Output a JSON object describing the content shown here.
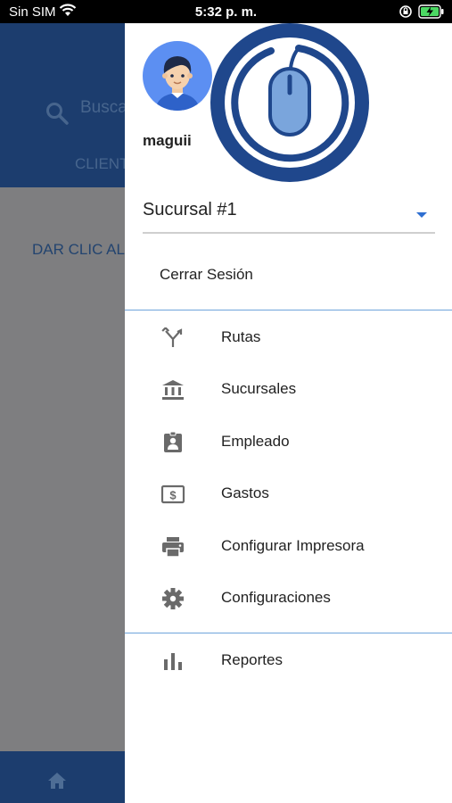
{
  "status_bar": {
    "carrier": "Sin SIM",
    "time": "5:32 p. m.",
    "icons": [
      "wifi-icon",
      "orientation-lock-icon",
      "battery-charging-icon"
    ]
  },
  "background_app": {
    "search_placeholder": "Busca",
    "tab_label": "CLIENT",
    "hint_text": "DAR CLIC AL",
    "header_color": "#1c3d6e",
    "overlay_color": "#7e7e80"
  },
  "drawer": {
    "username": "maguii",
    "branch_selected": "Sucursal #1",
    "logout_label": "Cerrar Sesión",
    "accent_color": "#2f6fd1",
    "menu_items": [
      {
        "label": "Rutas",
        "icon": "route-icon"
      },
      {
        "label": "Sucursales",
        "icon": "bank-icon"
      },
      {
        "label": "Empleado",
        "icon": "badge-icon"
      },
      {
        "label": "Gastos",
        "icon": "money-icon"
      },
      {
        "label": "Configurar Impresora",
        "icon": "printer-icon"
      },
      {
        "label": "Configuraciones",
        "icon": "gear-icon"
      }
    ],
    "reports_item": {
      "label": "Reportes",
      "icon": "bar-chart-icon"
    }
  }
}
